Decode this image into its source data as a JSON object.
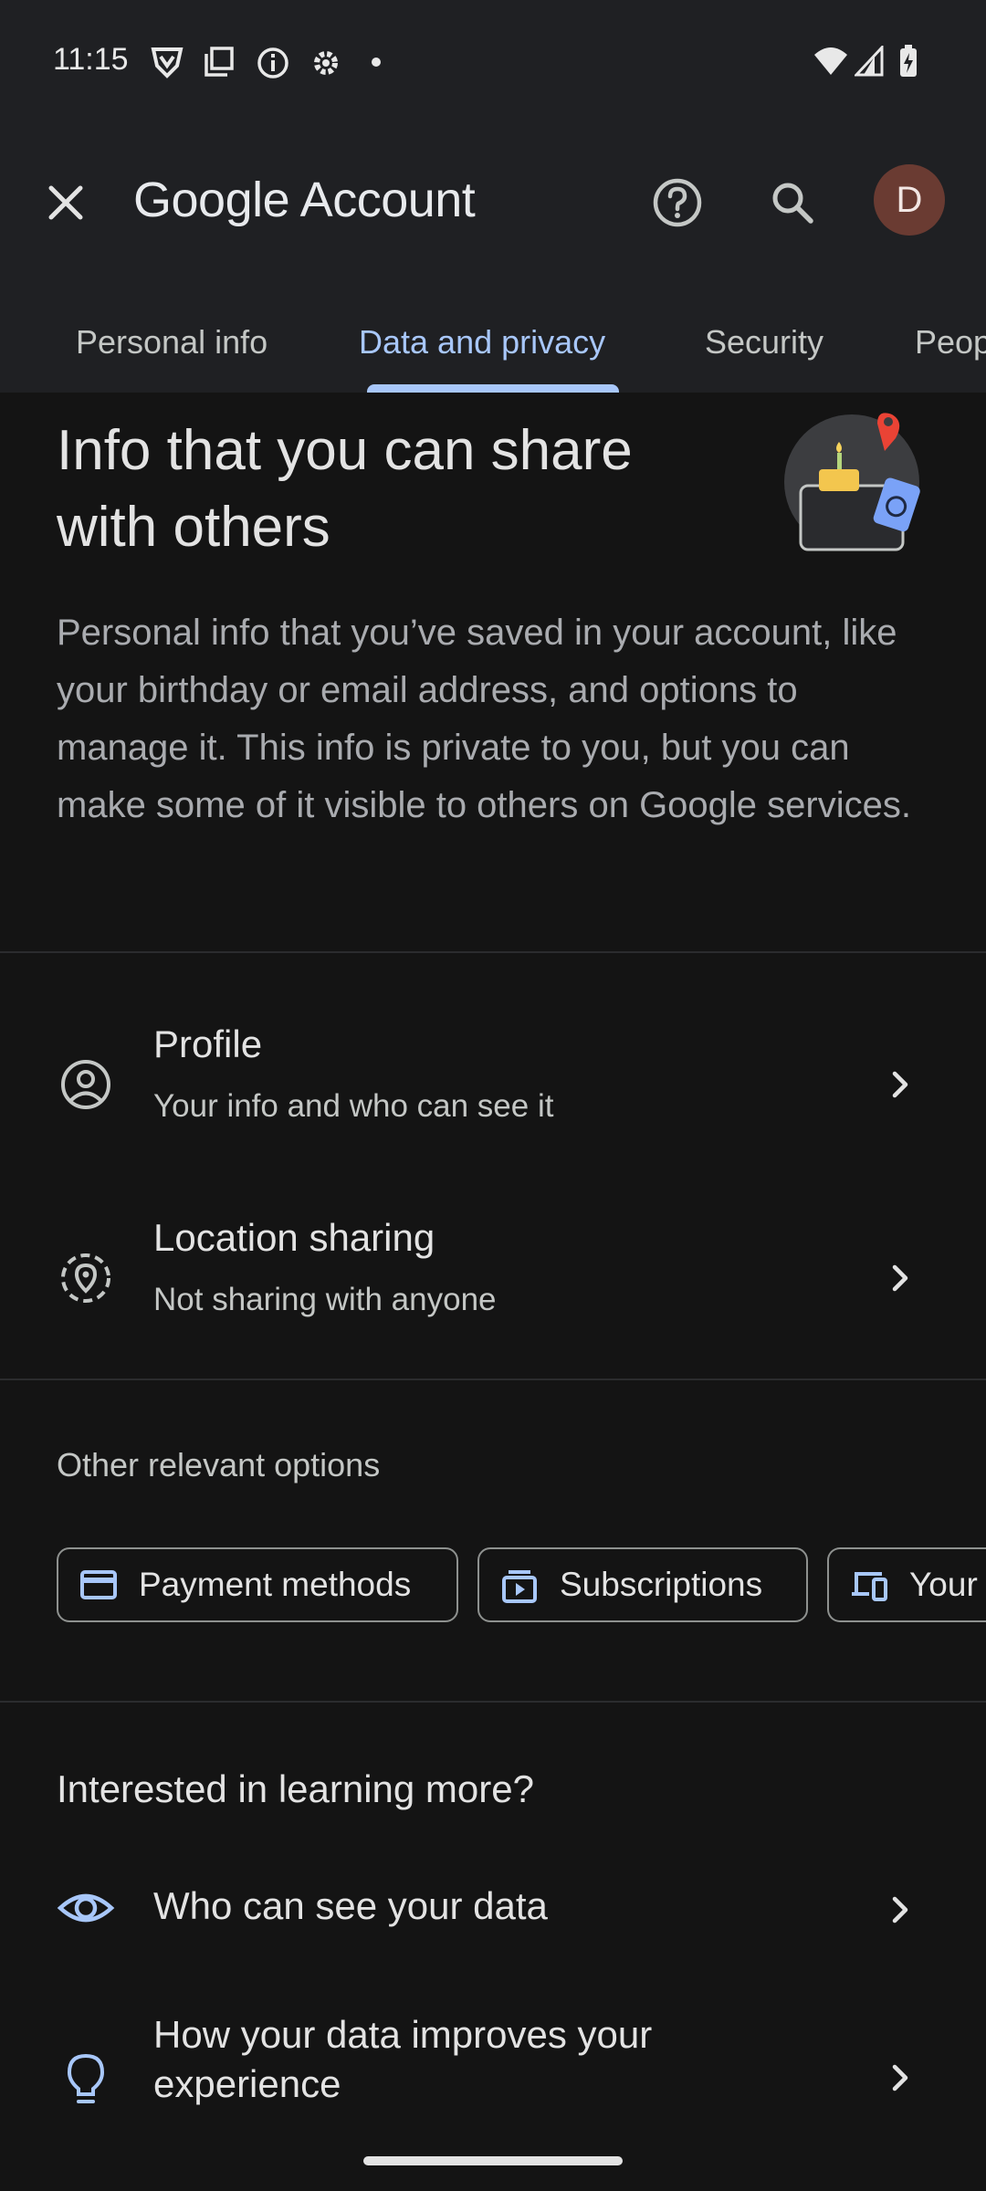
{
  "status_bar": {
    "time": "11:15",
    "icons": [
      "vpn-shield-icon",
      "screencast-icon",
      "info-icon",
      "settings-icon",
      "dot-icon",
      "wifi-icon",
      "signal-icon",
      "battery-charging-icon"
    ]
  },
  "app_bar": {
    "title_brand": "Google",
    "title_suffix": "Account",
    "avatar_letter": "D",
    "avatar_color": "#6a3b32",
    "close_icon": "close-icon",
    "help_icon": "help-icon",
    "search_icon": "search-icon"
  },
  "tabs": [
    {
      "label": "Personal info",
      "active": false
    },
    {
      "label": "Data and privacy",
      "active": true
    },
    {
      "label": "Security",
      "active": false
    },
    {
      "label": "Peop",
      "active": false
    }
  ],
  "header": {
    "headline": "Info that you can share with others",
    "description": "Personal info that you’ve saved in your account, like your birthday or email address, and options to manage it. This info is private to you, but you can make some of it visible to others on Google services."
  },
  "items": [
    {
      "title": "Profile",
      "subtitle": "Your info and who can see it",
      "icon": "account-circle-icon"
    },
    {
      "title": "Location sharing",
      "subtitle": "Not sharing with anyone",
      "icon": "location-sharing-icon"
    }
  ],
  "other_options": {
    "label": "Other relevant options",
    "chips": [
      {
        "label": "Payment methods",
        "icon": "credit-card-icon"
      },
      {
        "label": "Subscriptions",
        "icon": "subscriptions-icon"
      },
      {
        "label": "Your",
        "icon": "devices-icon"
      }
    ]
  },
  "learn_more": {
    "title": "Interested in learning more?",
    "items": [
      {
        "label": "Who can see your data",
        "icon": "eye-icon"
      },
      {
        "label": "How your data improves your experience",
        "icon": "lightbulb-icon"
      }
    ]
  },
  "colors": {
    "accent": "#a8c7fa",
    "background": "#141414",
    "app_bar": "#1f2023"
  }
}
